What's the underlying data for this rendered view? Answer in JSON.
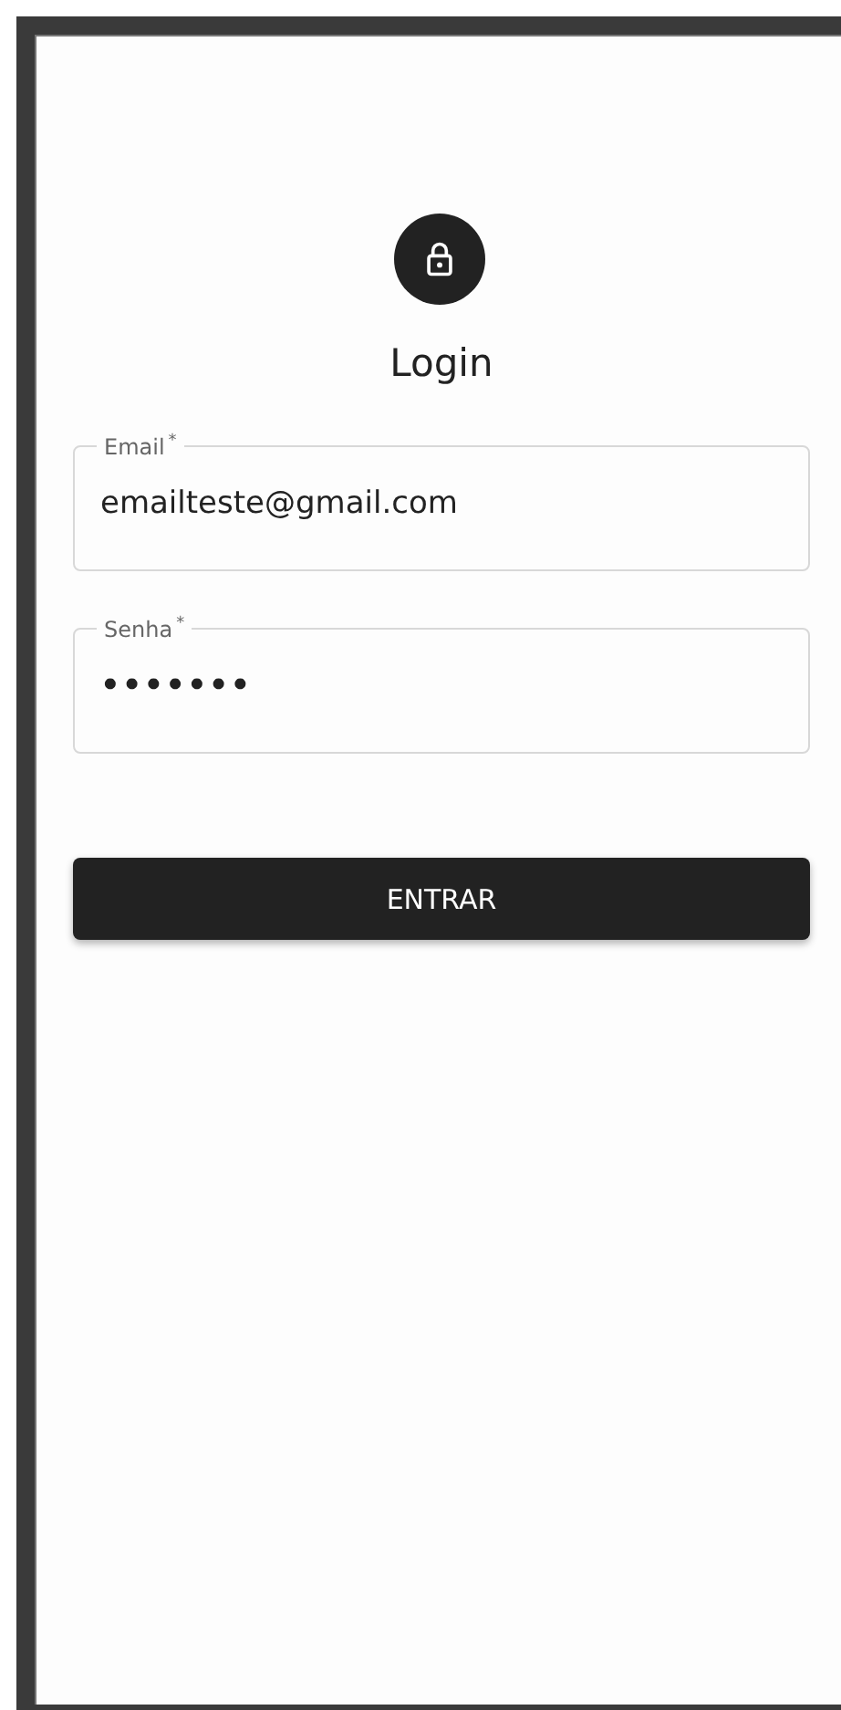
{
  "title": "Login",
  "fields": [
    {
      "kind": "email",
      "label": "Email",
      "required_mark": "*",
      "value": "emailteste@gmail.com"
    },
    {
      "kind": "password",
      "label": "Senha",
      "required_mark": "*",
      "value": "•••••••"
    }
  ],
  "submit_button": "ENTRAR"
}
